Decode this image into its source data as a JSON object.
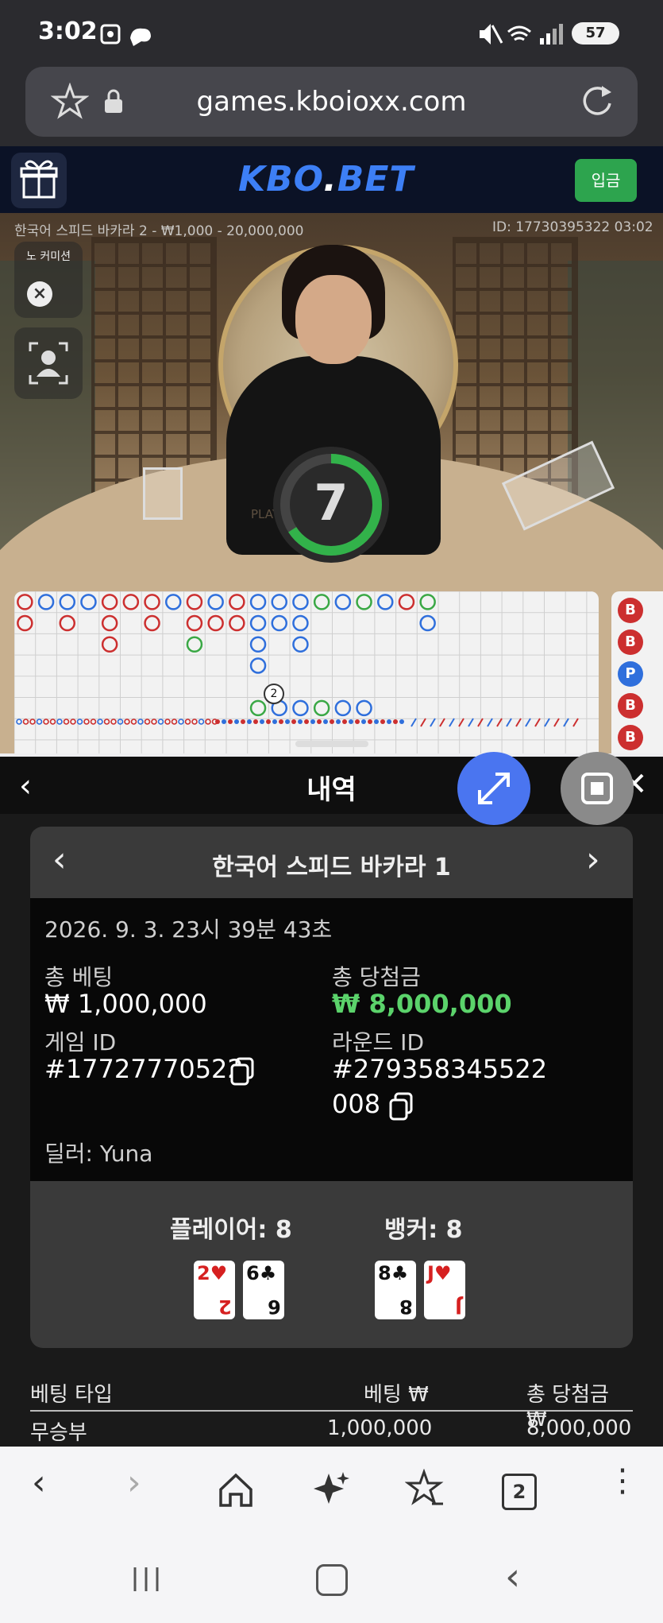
{
  "status_bar": {
    "time": "3:02",
    "battery": "57"
  },
  "browser": {
    "url": "games.kboioxx.com",
    "tabs_count": "2"
  },
  "site": {
    "logo_main": "KBO",
    "logo_dot": ".",
    "logo_suffix": "BET",
    "deposit_label": "입금"
  },
  "live": {
    "table_info": "한국어 스피드 바카라 2 - ₩1,000 - 20,000,000",
    "game_id": "ID: 17730395322 03:02",
    "countdown": "7",
    "no_commission_label": "노 커미션",
    "table_text": "PLAYER  BANKER",
    "roadmap_marker": "2",
    "side_beads": [
      "B",
      "B",
      "P",
      "B",
      "B"
    ]
  },
  "history": {
    "title": "내역",
    "game_name": "한국어 스피드 바카라 1",
    "datetime": "2026. 9. 3. 23시 39분 43초",
    "total_bet_label": "총 베팅",
    "total_bet_value": "₩ 1,000,000",
    "total_win_label": "총 당첨금",
    "total_win_value": "₩ 8,000,000",
    "game_id_label": "게임 ID",
    "game_id_value": "#17727770522",
    "round_id_label": "라운드 ID",
    "round_id_line1": "#279358345522",
    "round_id_line2": "008",
    "dealer": "딜러: Yuna",
    "player_label": "플레이어: 8",
    "banker_label": "뱅커: 8",
    "player_cards": [
      {
        "rank": "2",
        "suit": "♥"
      },
      {
        "rank": "6",
        "suit": "♣"
      }
    ],
    "banker_cards": [
      {
        "rank": "8",
        "suit": "♣"
      },
      {
        "rank": "J",
        "suit": "♥"
      }
    ],
    "bets_table": {
      "headers": [
        "베팅 타입",
        "베팅 ₩",
        "총 당첨금 ₩"
      ],
      "rows": [
        {
          "type": "무승부",
          "bet": "1,000,000",
          "win": "8,000,000"
        }
      ]
    }
  },
  "colors": {
    "accent": "#3d7ff5",
    "win_green": "#5bd36b",
    "deposit": "#2da44e",
    "player_blue": "#2f6fdc",
    "banker_red": "#cc2f2f"
  }
}
